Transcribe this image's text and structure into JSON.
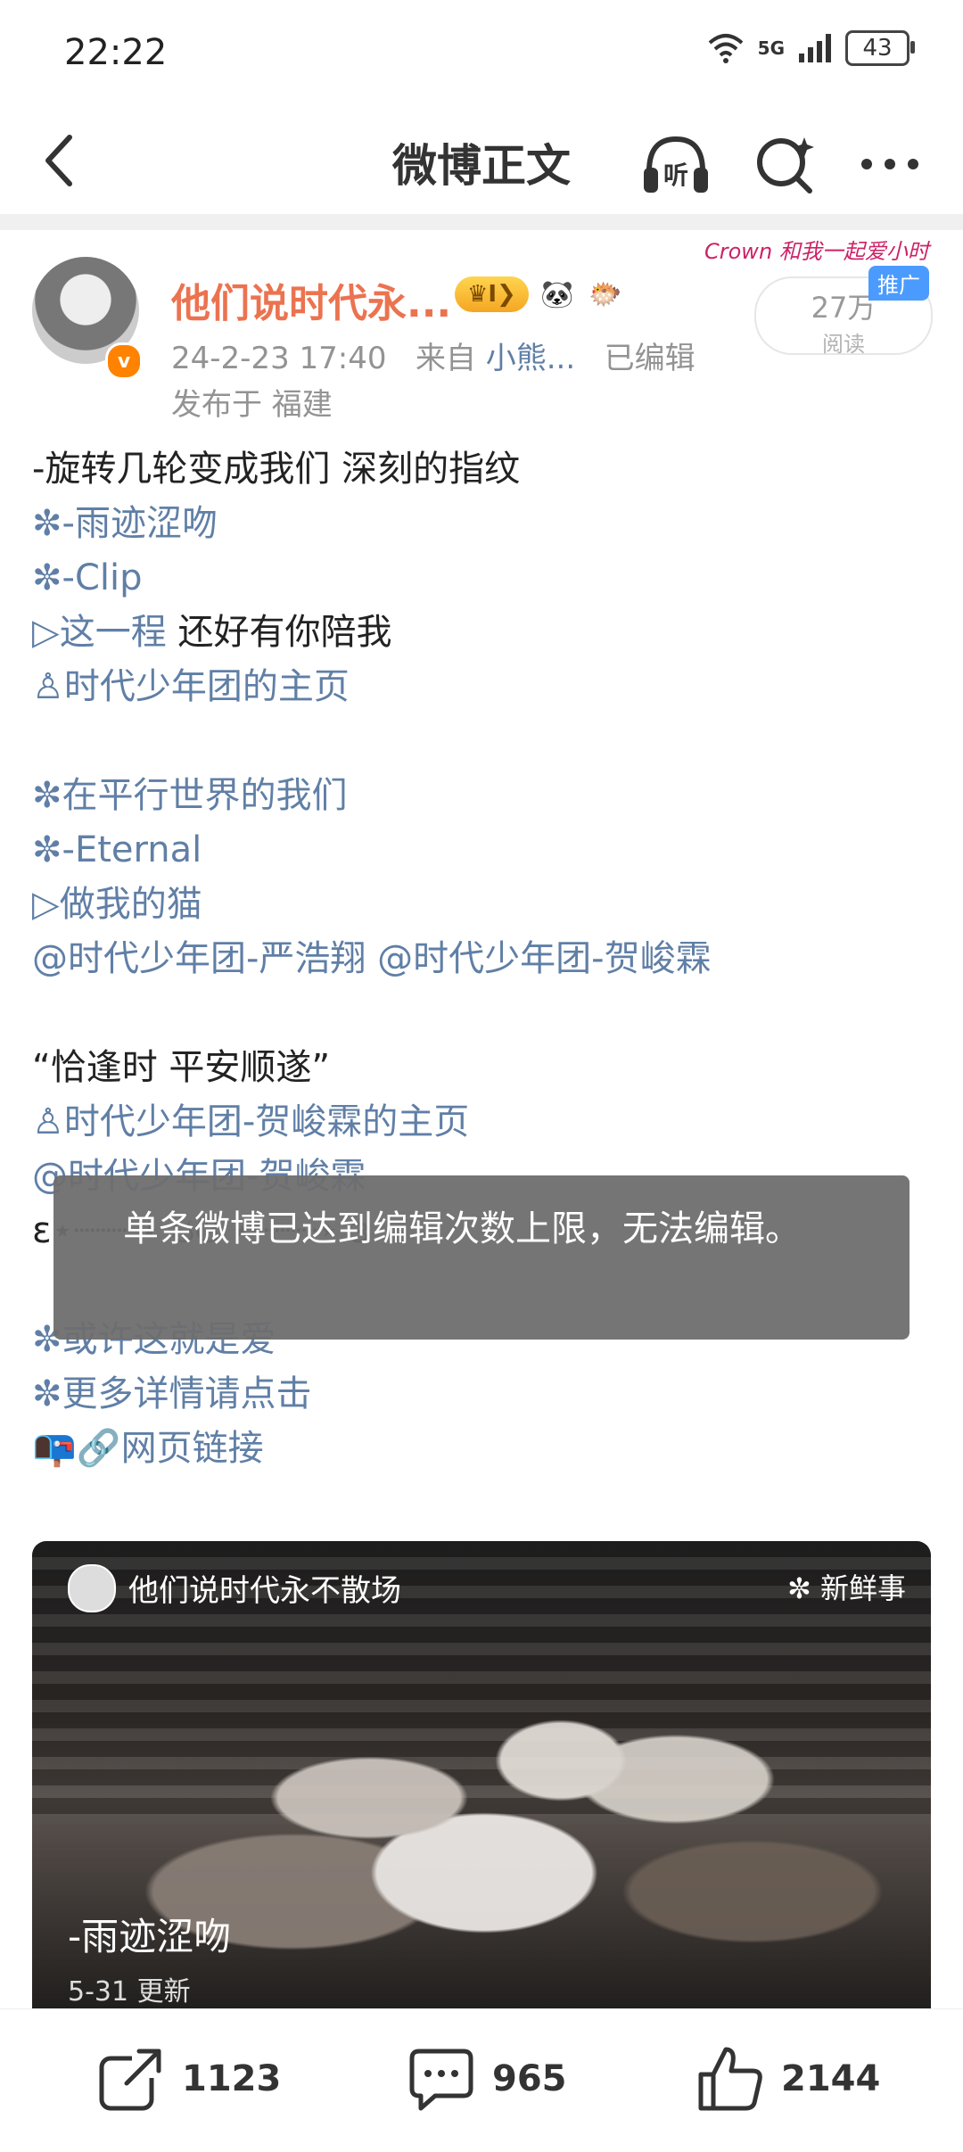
{
  "status": {
    "time": "22:22",
    "battery": "43",
    "network": "5G"
  },
  "nav": {
    "title": "微博正文",
    "listen_label": "听"
  },
  "post": {
    "username": "他们说时代永...",
    "level_badge": "I",
    "time": "24-2-23 17:40",
    "source_prefix": "来自",
    "source": "小熊...",
    "edited": "已编辑",
    "location": "发布于 福建",
    "reads": "27万",
    "reads_label": "阅读",
    "promo_tag": "推广",
    "crown_text": "Crown 和我一起爱小时"
  },
  "content_lines": [
    {
      "parts": [
        {
          "t": "-旋转几轮变成我们 深刻的指纹",
          "link": false
        }
      ]
    },
    {
      "parts": [
        {
          "t": "✼-雨迹涩吻",
          "link": true
        }
      ]
    },
    {
      "parts": [
        {
          "t": "✼-Clip",
          "link": true
        }
      ]
    },
    {
      "parts": [
        {
          "t": "▷这一程",
          "link": true
        },
        {
          "t": " 还好有你陪我",
          "link": false
        }
      ]
    },
    {
      "parts": [
        {
          "t": "♙时代少年团的主页",
          "link": true
        }
      ]
    },
    {
      "blank": true
    },
    {
      "parts": [
        {
          "t": "✼在平行世界的我们",
          "link": true
        }
      ]
    },
    {
      "parts": [
        {
          "t": "✼-Eternal",
          "link": true
        }
      ]
    },
    {
      "parts": [
        {
          "t": "▷做我的猫",
          "link": true
        }
      ]
    },
    {
      "parts": [
        {
          "t": "@时代少年团-严浩翔 @时代少年团-贺峻霖",
          "link": true
        }
      ]
    },
    {
      "blank": true
    },
    {
      "parts": [
        {
          "t": "“恰逢时 平安顺遂”",
          "link": false
        }
      ]
    },
    {
      "parts": [
        {
          "t": "♙时代少年团-贺峻霖的主页",
          "link": true
        }
      ]
    },
    {
      "parts": [
        {
          "t": "@时代少年团-贺峻霖",
          "link": true
        }
      ]
    },
    {
      "parts": [
        {
          "t": "ɛ⋆┈┈┈⋆ ઇଓ ⋆┈┈┈⋆ з",
          "link": false
        }
      ]
    },
    {
      "blank": true
    },
    {
      "parts": [
        {
          "t": "✼或许这就是爱",
          "link": true
        }
      ]
    },
    {
      "parts": [
        {
          "t": "✼更多详情请点击",
          "link": true
        }
      ]
    },
    {
      "parts": [
        {
          "t": "📭",
          "link": false
        },
        {
          "t": "🔗网页链接",
          "link": true
        }
      ]
    }
  ],
  "toast": "单条微博已达到编辑次数上限，无法编辑。",
  "card": {
    "name": "他们说时代永不散场",
    "tag": "✼ 新鲜事",
    "title": "-雨迹涩吻",
    "date": "5-31 更新"
  },
  "actions": {
    "repost": "1123",
    "comment": "965",
    "like": "2144"
  }
}
